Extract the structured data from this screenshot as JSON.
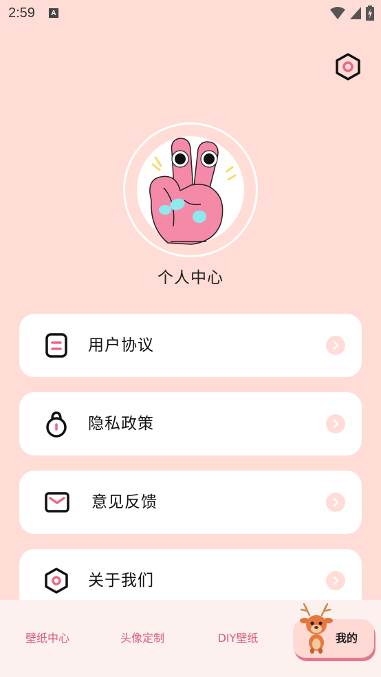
{
  "status_bar": {
    "time": "2:59",
    "notification_letter": "A"
  },
  "profile": {
    "title": "个人中心"
  },
  "menu": [
    {
      "label": "用户协议",
      "icon": "document-icon"
    },
    {
      "label": "隐私政策",
      "icon": "lock-icon"
    },
    {
      "label": "意见反馈",
      "icon": "mail-icon"
    },
    {
      "label": "关于我们",
      "icon": "hexagon-icon"
    }
  ],
  "bottom_nav": {
    "items": [
      {
        "label": "壁纸中心"
      },
      {
        "label": "头像定制"
      },
      {
        "label": "DIY壁纸"
      },
      {
        "label": "我的",
        "active": true
      }
    ]
  },
  "colors": {
    "background": "#ffdcd5",
    "accent": "#e05a78",
    "card": "#ffffff"
  }
}
